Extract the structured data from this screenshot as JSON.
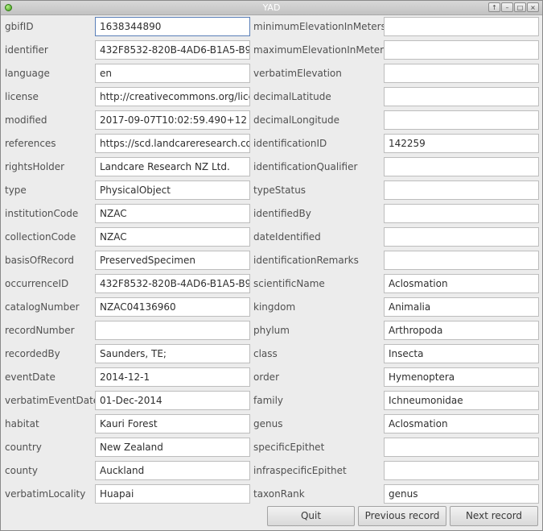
{
  "window": {
    "title": "YAD",
    "controls": [
      "↑",
      "–",
      "□",
      "×"
    ]
  },
  "left_fields": [
    {
      "label": "gbifID",
      "value": "1638344890"
    },
    {
      "label": "identifier",
      "value": "432F8532-820B-4AD6-B1A5-B9"
    },
    {
      "label": "language",
      "value": "en"
    },
    {
      "label": "license",
      "value": "http://creativecommons.org/lice"
    },
    {
      "label": "modified",
      "value": "2017-09-07T10:02:59.490+12"
    },
    {
      "label": "references",
      "value": "https://scd.landcareresearch.co"
    },
    {
      "label": "rightsHolder",
      "value": "Landcare Research NZ Ltd."
    },
    {
      "label": "type",
      "value": "PhysicalObject"
    },
    {
      "label": "institutionCode",
      "value": "NZAC"
    },
    {
      "label": "collectionCode",
      "value": "NZAC"
    },
    {
      "label": "basisOfRecord",
      "value": "PreservedSpecimen"
    },
    {
      "label": "occurrenceID",
      "value": "432F8532-820B-4AD6-B1A5-B9"
    },
    {
      "label": "catalogNumber",
      "value": "NZAC04136960"
    },
    {
      "label": "recordNumber",
      "value": ""
    },
    {
      "label": "recordedBy",
      "value": "Saunders, TE;"
    },
    {
      "label": "eventDate",
      "value": "2014-12-1"
    },
    {
      "label": "verbatimEventDate",
      "value": "01-Dec-2014"
    },
    {
      "label": "habitat",
      "value": "Kauri Forest"
    },
    {
      "label": "country",
      "value": "New Zealand"
    },
    {
      "label": "county",
      "value": "Auckland"
    },
    {
      "label": "verbatimLocality",
      "value": "Huapai"
    }
  ],
  "right_fields": [
    {
      "label": "minimumElevationInMeters",
      "value": ""
    },
    {
      "label": "maximumElevationInMeters",
      "value": ""
    },
    {
      "label": "verbatimElevation",
      "value": ""
    },
    {
      "label": "decimalLatitude",
      "value": ""
    },
    {
      "label": "decimalLongitude",
      "value": ""
    },
    {
      "label": "identificationID",
      "value": "142259"
    },
    {
      "label": "identificationQualifier",
      "value": ""
    },
    {
      "label": "typeStatus",
      "value": ""
    },
    {
      "label": "identifiedBy",
      "value": ""
    },
    {
      "label": "dateIdentified",
      "value": ""
    },
    {
      "label": "identificationRemarks",
      "value": ""
    },
    {
      "label": "scientificName",
      "value": "Aclosmation"
    },
    {
      "label": "kingdom",
      "value": "Animalia"
    },
    {
      "label": "phylum",
      "value": "Arthropoda"
    },
    {
      "label": "class",
      "value": "Insecta"
    },
    {
      "label": "order",
      "value": "Hymenoptera"
    },
    {
      "label": "family",
      "value": "Ichneumonidae"
    },
    {
      "label": "genus",
      "value": "Aclosmation"
    },
    {
      "label": "specificEpithet",
      "value": ""
    },
    {
      "label": "infraspecificEpithet",
      "value": ""
    },
    {
      "label": "taxonRank",
      "value": "genus"
    }
  ],
  "buttons": {
    "quit": "Quit",
    "previous": "Previous record",
    "next": "Next record"
  }
}
